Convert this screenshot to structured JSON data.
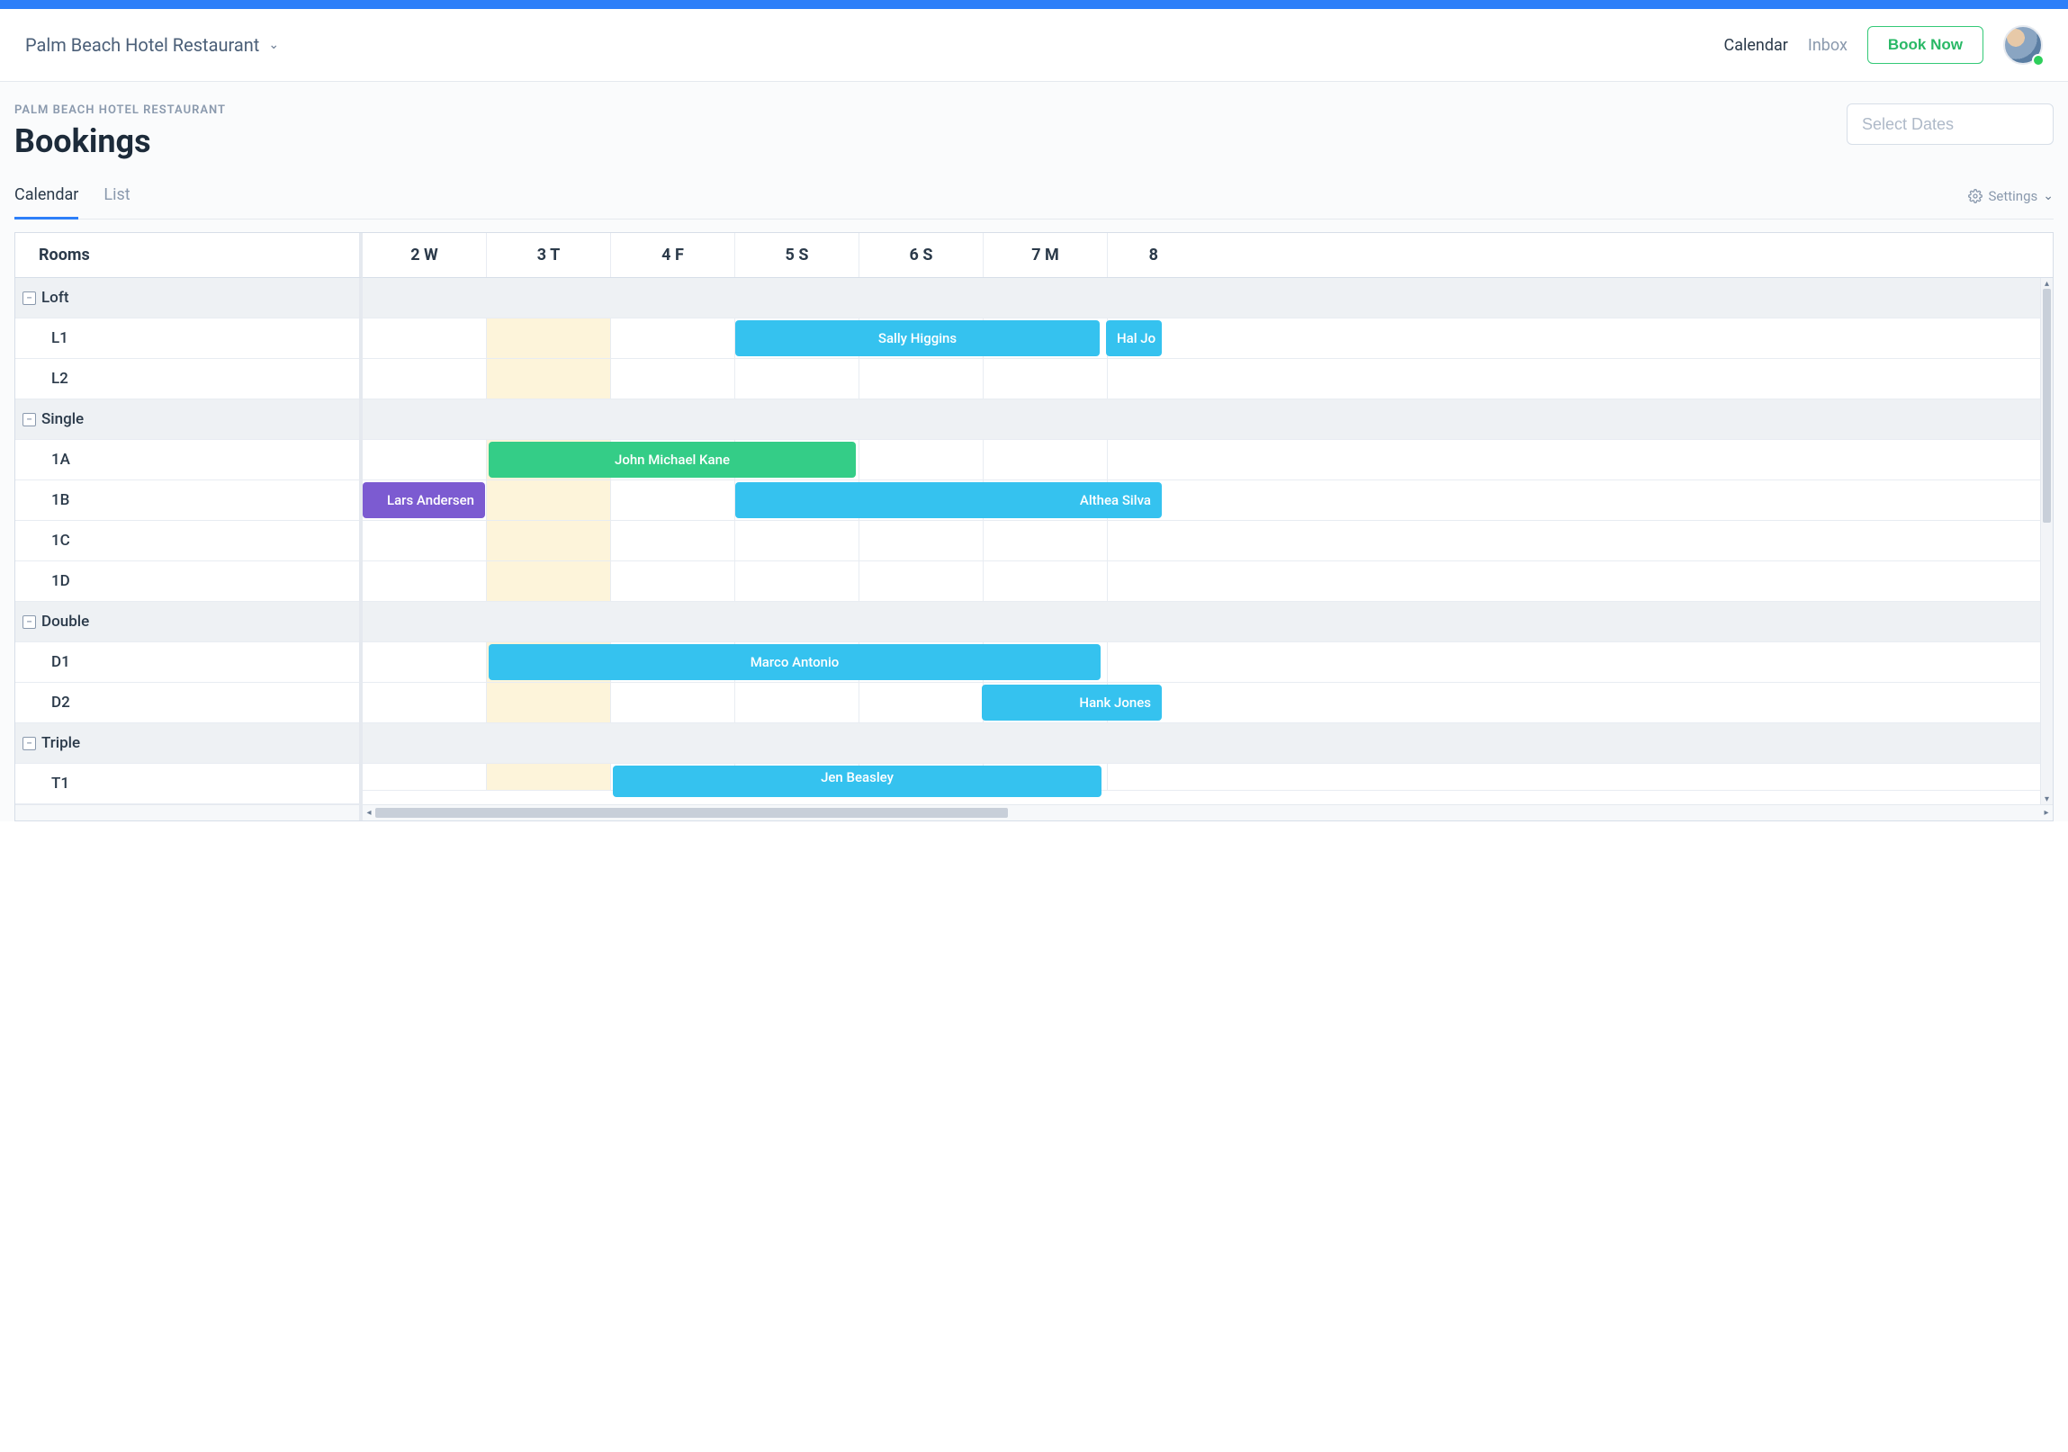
{
  "header": {
    "venue_name": "Palm Beach Hotel Restaurant",
    "nav_calendar": "Calendar",
    "nav_inbox": "Inbox",
    "book_now_label": "Book Now"
  },
  "page": {
    "breadcrumb": "PALM BEACH HOTEL RESTAURANT",
    "title": "Bookings",
    "date_placeholder": "Select Dates"
  },
  "tabs": {
    "calendar": "Calendar",
    "list": "List",
    "settings": "Settings"
  },
  "calendar": {
    "rooms_header": "Rooms",
    "days": [
      "2 W",
      "3 T",
      "4 F",
      "5 S",
      "6 S",
      "7 M"
    ],
    "day_partial": "8",
    "groups": [
      {
        "name": "Loft",
        "rooms": [
          "L1",
          "L2"
        ]
      },
      {
        "name": "Single",
        "rooms": [
          "1A",
          "1B",
          "1C",
          "1D"
        ]
      },
      {
        "name": "Double",
        "rooms": [
          "D1",
          "D2"
        ]
      },
      {
        "name": "Triple",
        "rooms": [
          "T1"
        ]
      }
    ],
    "bookings": {
      "L1_a": "Sally Higgins",
      "L1_b": "Hal Jo",
      "1A_a": "John Michael Kane",
      "1B_a": "Lars Andersen",
      "1B_b": "Althea Silva",
      "D1_a": "Marco Antonio",
      "D2_a": "Hank Jones",
      "T1_a": "Jen Beasley"
    }
  }
}
